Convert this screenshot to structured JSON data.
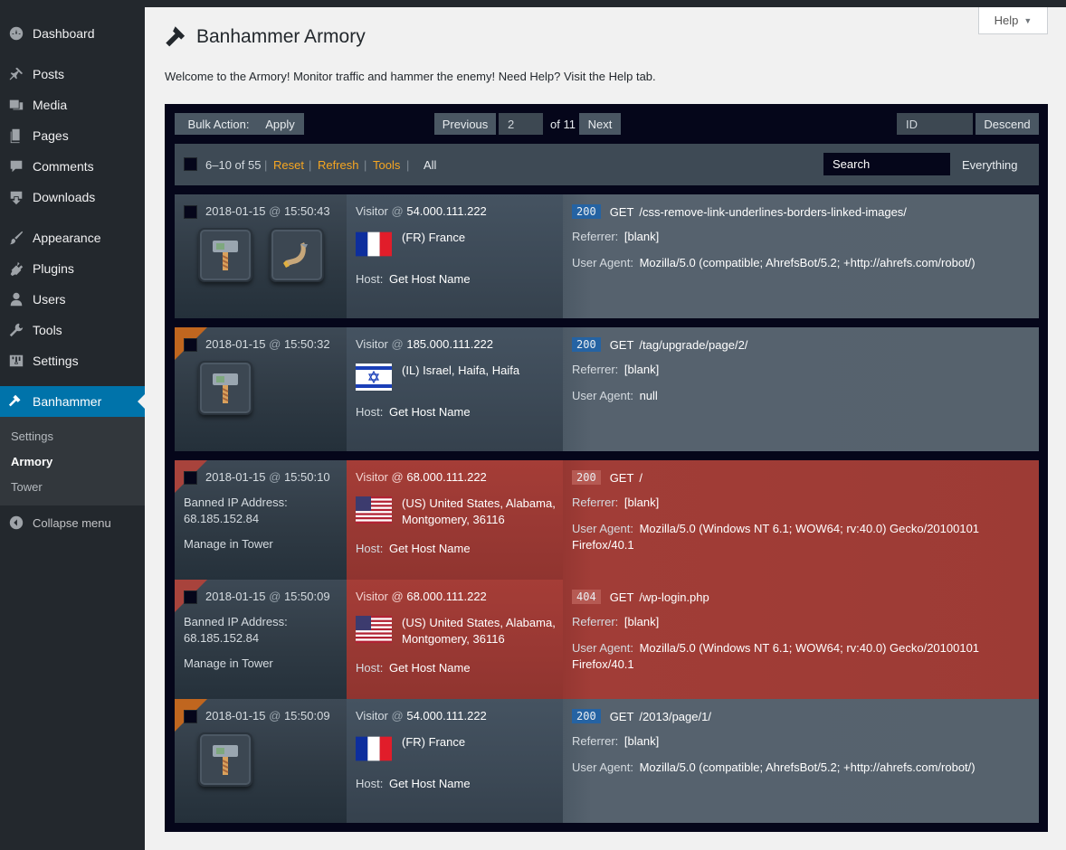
{
  "sidebar": {
    "items": [
      {
        "label": "Dashboard",
        "icon": "dashboard-icon"
      },
      {
        "label": "Posts",
        "icon": "pushpin-icon"
      },
      {
        "label": "Media",
        "icon": "media-icon"
      },
      {
        "label": "Pages",
        "icon": "pages-icon"
      },
      {
        "label": "Comments",
        "icon": "comment-icon"
      },
      {
        "label": "Downloads",
        "icon": "download-icon"
      },
      {
        "label": "Appearance",
        "icon": "brush-icon"
      },
      {
        "label": "Plugins",
        "icon": "plugin-icon"
      },
      {
        "label": "Users",
        "icon": "user-icon"
      },
      {
        "label": "Tools",
        "icon": "wrench-icon"
      },
      {
        "label": "Settings",
        "icon": "sliders-icon"
      },
      {
        "label": "Banhammer",
        "icon": "hammer-icon"
      }
    ],
    "submenu": [
      "Settings",
      "Armory",
      "Tower"
    ],
    "collapse": "Collapse menu",
    "accent": "#0073aa"
  },
  "help": {
    "label": "Help"
  },
  "page": {
    "title": "Banhammer Armory",
    "welcome": "Welcome to the Armory! Monitor traffic and hammer the enemy! Need Help? Visit the Help tab."
  },
  "toolbar": {
    "bulk_action": "Bulk Action:",
    "apply": "Apply",
    "previous": "Previous",
    "page": "2",
    "of_pages": "of 11",
    "next": "Next",
    "sort_field": "ID",
    "sort_order": "Descend"
  },
  "filter": {
    "range": "6–10 of 55",
    "reset": "Reset",
    "refresh": "Refresh",
    "tools": "Tools",
    "all": "All",
    "search": "Search",
    "scope": "Everything",
    "sep": "|",
    "link_color": "#f7a621"
  },
  "rows": [
    {
      "date": "2018-01-15",
      "at": "@",
      "time": "15:50:43",
      "visitor_label": "Visitor",
      "at2": "@",
      "ip": "54.000.111.222",
      "location": "(FR) France",
      "host_label": "Host:",
      "host": "Get Host Name",
      "code": "200",
      "method": "GET",
      "url": "/css-remove-link-underlines-borders-linked-images/",
      "referrer_label": "Referrer:",
      "referrer": "[blank]",
      "ua_label": "User Agent:",
      "ua": "Mozilla/5.0 (compatible; AhrefsBot/5.2; +http://ahrefs.com/robot/)",
      "icons": [
        "hammer-icon",
        "horn-icon"
      ]
    },
    {
      "date": "2018-01-15",
      "at": "@",
      "time": "15:50:32",
      "visitor_label": "Visitor",
      "at2": "@",
      "ip": "185.000.111.222",
      "location": "(IL) Israel, Haifa, Haifa",
      "host_label": "Host:",
      "host": "Get Host Name",
      "code": "200",
      "method": "GET",
      "url": "/tag/upgrade/page/2/",
      "referrer_label": "Referrer:",
      "referrer": "[blank]",
      "ua_label": "User Agent:",
      "ua": "null",
      "icons": [
        "hammer-icon"
      ]
    },
    {
      "date": "2018-01-15",
      "at": "@",
      "time": "15:50:10",
      "visitor_label": "Visitor",
      "at2": "@",
      "ip": "68.000.111.222",
      "location": "(US) United States, Alabama, Montgomery, 36116",
      "host_label": "Host:",
      "host": "Get Host Name",
      "code": "200",
      "method": "GET",
      "url": "/",
      "referrer_label": "Referrer:",
      "referrer": "[blank]",
      "ua_label": "User Agent:",
      "ua": "Mozilla/5.0 (Windows NT 6.1; WOW64; rv:40.0) Gecko/20100101 Firefox/40.1",
      "banned_label": "Banned IP Address:",
      "banned_ip": "68.185.152.84",
      "manage": "Manage in Tower"
    },
    {
      "date": "2018-01-15",
      "at": "@",
      "time": "15:50:09",
      "visitor_label": "Visitor",
      "at2": "@",
      "ip": "68.000.111.222",
      "location": "(US) United States, Alabama, Montgomery, 36116",
      "host_label": "Host:",
      "host": "Get Host Name",
      "code": "404",
      "method": "GET",
      "url": "/wp-login.php",
      "referrer_label": "Referrer:",
      "referrer": "[blank]",
      "ua_label": "User Agent:",
      "ua": "Mozilla/5.0 (Windows NT 6.1; WOW64; rv:40.0) Gecko/20100101 Firefox/40.1",
      "banned_label": "Banned IP Address:",
      "banned_ip": "68.185.152.84",
      "manage": "Manage in Tower"
    },
    {
      "date": "2018-01-15",
      "at": "@",
      "time": "15:50:09",
      "visitor_label": "Visitor",
      "at2": "@",
      "ip": "54.000.111.222",
      "location": "(FR) France",
      "host_label": "Host:",
      "host": "Get Host Name",
      "code": "200",
      "method": "GET",
      "url": "/2013/page/1/",
      "referrer_label": "Referrer:",
      "referrer": "[blank]",
      "ua_label": "User Agent:",
      "ua": "Mozilla/5.0 (compatible; AhrefsBot/5.2; +http://ahrefs.com/robot/)",
      "icons": [
        "hammer-icon"
      ]
    }
  ]
}
